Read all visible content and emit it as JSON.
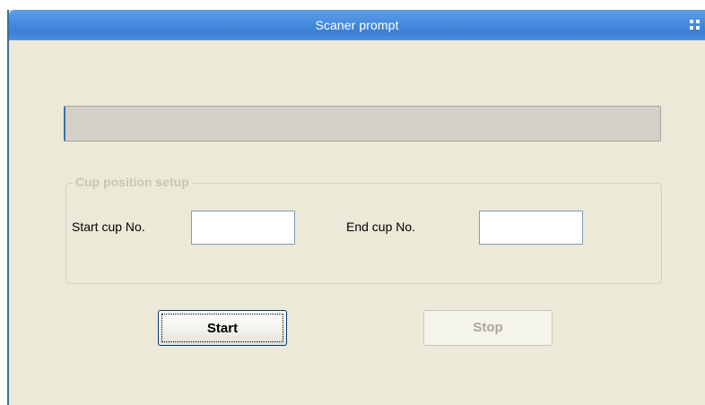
{
  "window": {
    "title": "Scaner prompt",
    "title_icon": "grid-icon"
  },
  "progress": {
    "value": 0
  },
  "cup_setup": {
    "legend": "Cup position setup",
    "start_label": "Start cup No.",
    "start_value": "",
    "end_label": "End cup No.",
    "end_value": ""
  },
  "buttons": {
    "start_label": "Start",
    "stop_label": "Stop"
  },
  "colors": {
    "titlebar": "#3b7fd6",
    "window_bg": "#ece9d8",
    "disabled_text": "#aca899"
  }
}
